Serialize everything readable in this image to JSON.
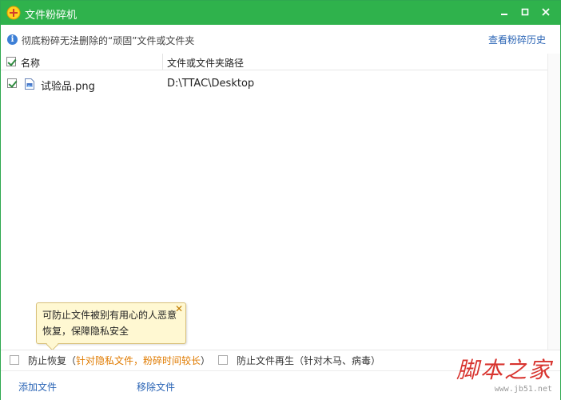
{
  "window": {
    "title": "文件粉碎机",
    "accent": "#2fb24c"
  },
  "infobar": {
    "message": "彻底粉碎无法删除的“顽固”文件或文件夹",
    "history_link": "查看粉碎历史"
  },
  "table": {
    "columns": [
      "名称",
      "文件或文件夹路径"
    ],
    "header_checked": true,
    "rows": [
      {
        "checked": true,
        "name": "试验品.png",
        "path": "D:\\TTAC\\Desktop",
        "icon": "image-file-icon"
      }
    ]
  },
  "tooltip": {
    "line1": "可防止文件被别有用心的人恶意",
    "line2": "恢复，保障隐私安全",
    "close": "✕"
  },
  "options": {
    "prevent_recovery_label": "防止恢复（",
    "prevent_recovery_note": "针对隐私文件，粉碎时间较长",
    "prevent_recovery_close": "）",
    "prevent_regen_label": "防止文件再生（针对木马、病毒）"
  },
  "footer": {
    "add_file": "添加文件",
    "remove_file": "移除文件"
  },
  "watermark": {
    "text": "脚本之家",
    "url": "www.jb51.net"
  }
}
